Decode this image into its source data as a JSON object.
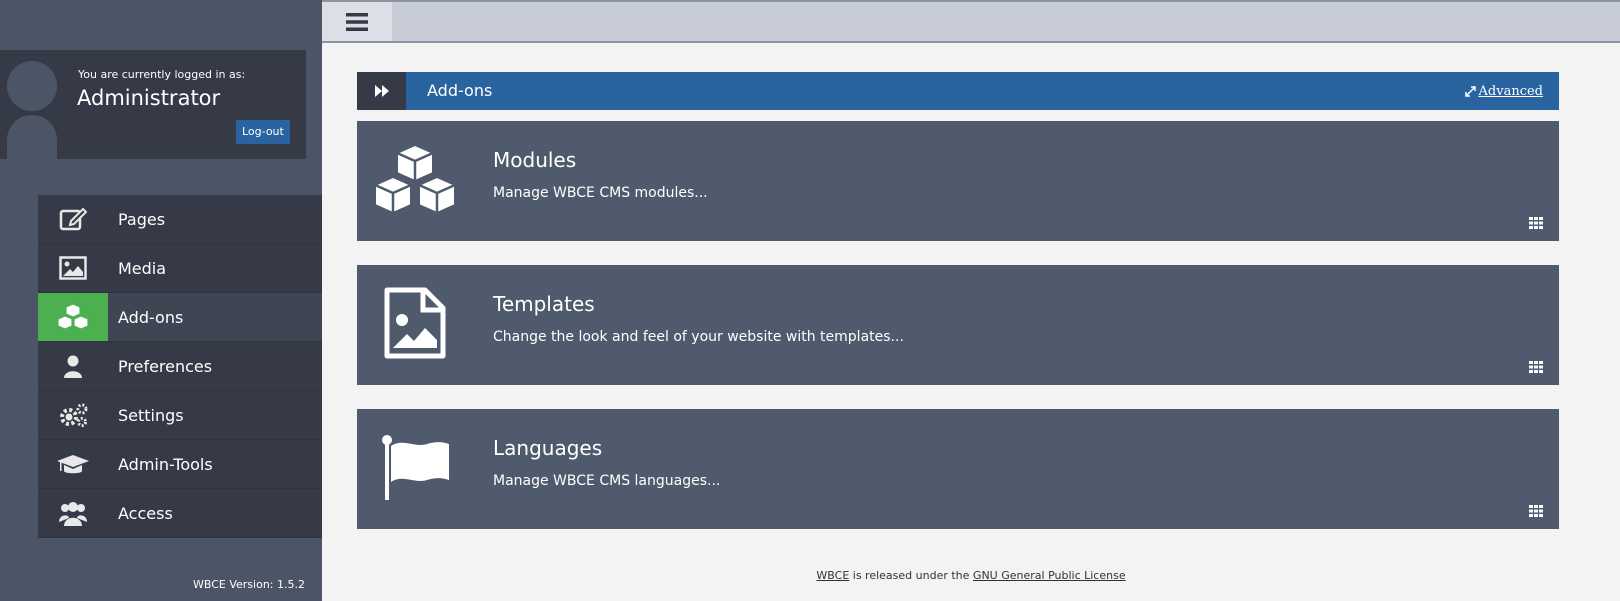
{
  "topbar": {
    "menu_icon": "hamburger-icon"
  },
  "user": {
    "logged_in_label": "You are currently logged in as:",
    "name": "Administrator",
    "logout_label": "Log-out"
  },
  "nav": {
    "items": [
      {
        "label": "Pages",
        "icon": "edit-icon"
      },
      {
        "label": "Media",
        "icon": "image-icon"
      },
      {
        "label": "Add-ons",
        "icon": "cubes-icon",
        "active": true
      },
      {
        "label": "Preferences",
        "icon": "user-icon"
      },
      {
        "label": "Settings",
        "icon": "gears-icon"
      },
      {
        "label": "Admin-Tools",
        "icon": "graduation-cap-icon"
      },
      {
        "label": "Access",
        "icon": "users-icon"
      }
    ]
  },
  "version": "WBCE Version: 1.5.2",
  "section": {
    "title": "Add-ons",
    "advanced_label": "Advanced"
  },
  "cards": [
    {
      "title": "Modules",
      "description": "Manage WBCE CMS modules...",
      "icon": "cubes-icon"
    },
    {
      "title": "Templates",
      "description": "Change the look and feel of your website with templates...",
      "icon": "file-image-icon"
    },
    {
      "title": "Languages",
      "description": "Manage WBCE CMS languages...",
      "icon": "flag-icon"
    }
  ],
  "footer": {
    "link1": "WBCE",
    "middle": " is released under the ",
    "link2": "GNU General Public License"
  },
  "colors": {
    "sidebar_bg": "#4c5566",
    "nav_bg": "#353a46",
    "active_green": "#4caf50",
    "header_blue": "#2964a0",
    "card_bg": "#4f5b6d",
    "main_bg": "#f3f3f3"
  }
}
